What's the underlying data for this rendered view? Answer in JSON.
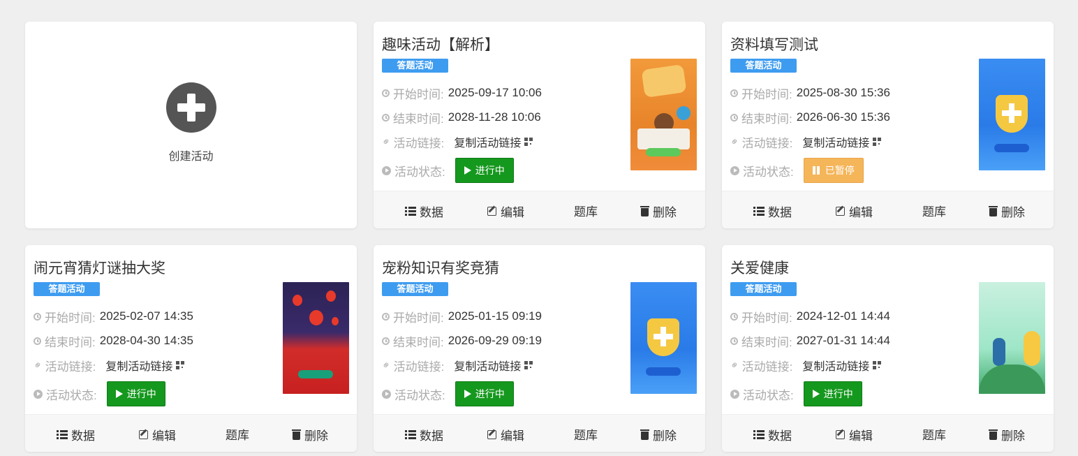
{
  "create": {
    "label": "创建活动"
  },
  "labels": {
    "start": "开始时间:",
    "end": "结束时间:",
    "link": "活动链接:",
    "status": "活动状态:",
    "copy_link": "复制活动链接"
  },
  "actions": {
    "data": "数据",
    "edit": "编辑",
    "bank": "题库",
    "delete": "删除"
  },
  "colors": {
    "tag": "#3e9cf0",
    "running": "#15981e",
    "paused": "#f5b559"
  },
  "activities": [
    {
      "title": "趣味活动【解析】",
      "tag": "答题活动",
      "start": "2025-09-17 10:06",
      "end": "2028-11-28 10:06",
      "status": "进行中",
      "status_type": "running",
      "poster": "child-reading-poster"
    },
    {
      "title": "资料填写测试",
      "tag": "答题活动",
      "start": "2025-08-30 15:36",
      "end": "2026-06-30 15:36",
      "status": "已暂停",
      "status_type": "paused",
      "poster": "network-security-poster"
    },
    {
      "title": "闹元宵猜灯谜抽大奖",
      "tag": "答题活动",
      "start": "2025-02-07 14:35",
      "end": "2028-04-30 14:35",
      "status": "进行中",
      "status_type": "running",
      "poster": "lantern-festival-poster"
    },
    {
      "title": "宠粉知识有奖竞猜",
      "tag": "答题活动",
      "start": "2025-01-15 09:19",
      "end": "2026-09-29 09:19",
      "status": "进行中",
      "status_type": "running",
      "poster": "network-security-poster"
    },
    {
      "title": "关爱健康",
      "tag": "答题活动",
      "start": "2024-12-01 14:44",
      "end": "2027-01-31 14:44",
      "status": "进行中",
      "status_type": "running",
      "poster": "health-quiz-poster"
    }
  ]
}
